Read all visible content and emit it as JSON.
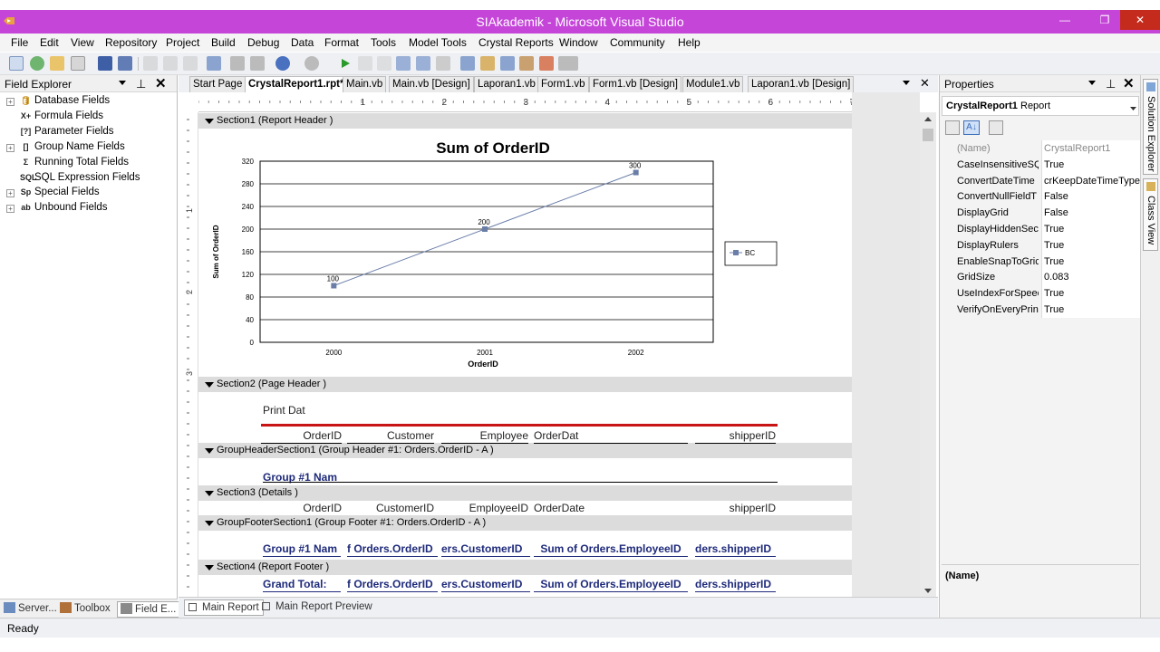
{
  "window": {
    "title": "SIAkademik - Microsoft Visual Studio",
    "min": "—",
    "max": "❐",
    "close": "✕"
  },
  "menu": [
    "File",
    "Edit",
    "View",
    "Repository",
    "Project",
    "Build",
    "Debug",
    "Data",
    "Format",
    "Tools",
    "Model Tools",
    "Crystal Reports",
    "Window",
    "Community",
    "Help"
  ],
  "field_explorer": {
    "title": "Field Explorer",
    "items": [
      {
        "label": "Database Fields",
        "icon": "database-icon",
        "expandable": true
      },
      {
        "label": "Formula Fields",
        "icon": "formula-icon",
        "expandable": false
      },
      {
        "label": "Parameter Fields",
        "icon": "parameter-icon",
        "expandable": false
      },
      {
        "label": "Group Name Fields",
        "icon": "group-icon",
        "expandable": true
      },
      {
        "label": "Running Total Fields",
        "icon": "sum-icon",
        "expandable": false
      },
      {
        "label": "SQL Expression Fields",
        "icon": "sql-icon",
        "expandable": false
      },
      {
        "label": "Special Fields",
        "icon": "special-icon",
        "expandable": true
      },
      {
        "label": "Unbound Fields",
        "icon": "unbound-icon",
        "expandable": true
      }
    ],
    "icon_glyphs": [
      "🛢",
      "X+",
      "[?]",
      "[]",
      "Σ",
      "SQL",
      "Sp",
      "ab"
    ]
  },
  "left_tabs": [
    "Server...",
    "Toolbox",
    "Field E..."
  ],
  "doc_tabs": [
    "Start Page",
    "CrystalReport1.rpt*",
    "Main.vb",
    "Main.vb [Design]",
    "Laporan1.vb",
    "Form1.vb",
    "Form1.vb [Design]",
    "Module1.vb",
    "Laporan1.vb [Design]"
  ],
  "ruler_marks": [
    "1",
    "2",
    "3",
    "4",
    "5",
    "6",
    "7"
  ],
  "vruler_marks": [
    "1",
    "2",
    "3"
  ],
  "sections": [
    {
      "label": "Section1 (Report Header  )"
    },
    {
      "label": "Section2 (Page Header  )"
    },
    {
      "label": "GroupHeaderSection1 (Group Header #1: Orders.OrderID - A )"
    },
    {
      "label": "Section3 (Details  )"
    },
    {
      "label": "GroupFooterSection1 (Group Footer #1: Orders.OrderID - A )"
    },
    {
      "label": "Section4 (Report Footer  )"
    }
  ],
  "page_header": {
    "print_date": "Print Dat",
    "columns": [
      "OrderID",
      "Customer",
      "Employee",
      "OrderDat",
      "shipperID"
    ]
  },
  "group_header": {
    "name": "Group #1 Nam"
  },
  "details": {
    "columns": [
      "OrderID",
      "CustomerID",
      "EmployeeID",
      "OrderDate",
      "shipperID"
    ]
  },
  "group_footer": {
    "fields": [
      "Group #1 Nam",
      "f Orders.OrderID",
      "ers.CustomerID",
      "Sum of Orders.EmployeeID",
      "ders.shipperID"
    ]
  },
  "report_footer": {
    "fields": [
      "Grand Total:",
      "f Orders.OrderID",
      "ers.CustomerID",
      "Sum of Orders.EmployeeID",
      "ders.shipperID"
    ]
  },
  "chart_data": {
    "type": "line",
    "title": "Sum of OrderID",
    "xlabel": "OrderID",
    "ylabel": "Sum of OrderID",
    "categories": [
      "2000",
      "2001",
      "2002"
    ],
    "series": [
      {
        "name": "BC",
        "values": [
          100,
          200,
          300
        ]
      }
    ],
    "ylim": [
      0,
      320
    ],
    "yticks": [
      0,
      40,
      80,
      120,
      160,
      200,
      240,
      280,
      320
    ],
    "grid": true,
    "legend": "right",
    "data_labels": [
      "100",
      "200",
      "300"
    ],
    "color": "#6a7ea8"
  },
  "bottom_tabs": [
    "Main Report",
    "Main Report Preview"
  ],
  "properties": {
    "title": "Properties",
    "object": "CrystalReport1",
    "object_type": "Report",
    "rows": [
      {
        "name": "(Name)",
        "value": "CrystalReport1",
        "muted": true
      },
      {
        "name": "CaseInsensitiveSQ",
        "value": "True"
      },
      {
        "name": "ConvertDateTime",
        "value": "crKeepDateTimeType"
      },
      {
        "name": "ConvertNullFieldT",
        "value": "False"
      },
      {
        "name": "DisplayGrid",
        "value": "False"
      },
      {
        "name": "DisplayHiddenSec",
        "value": "True"
      },
      {
        "name": "DisplayRulers",
        "value": "True"
      },
      {
        "name": "EnableSnapToGric",
        "value": "True"
      },
      {
        "name": "GridSize",
        "value": "0.083"
      },
      {
        "name": "UseIndexForSpeec",
        "value": "True"
      },
      {
        "name": "VerifyOnEveryPrin",
        "value": "True"
      }
    ],
    "desc_title": "(Name)"
  },
  "side_tabs": [
    "Solution Explorer",
    "Class View"
  ],
  "status": "Ready"
}
